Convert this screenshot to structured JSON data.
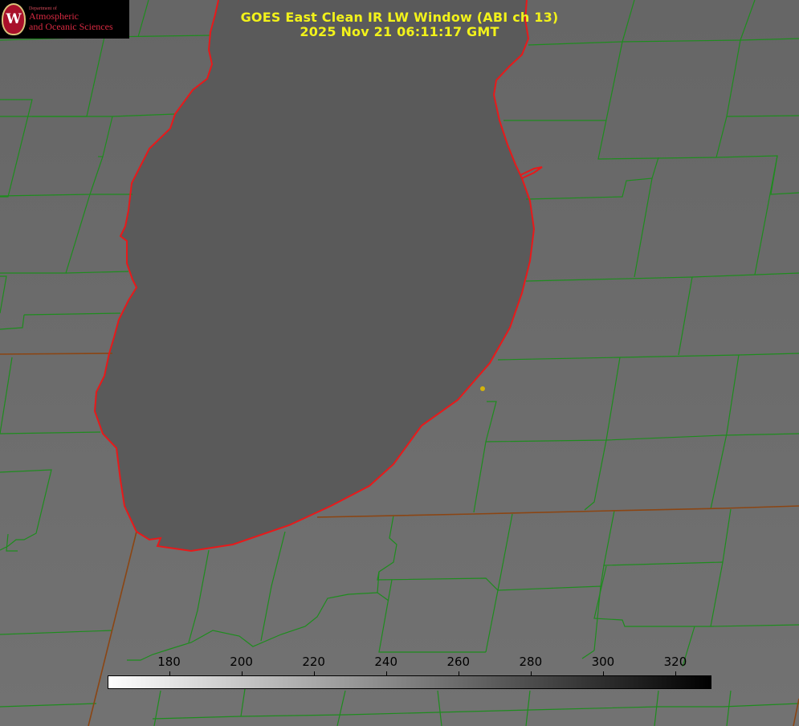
{
  "header": {
    "title_line1": "GOES East Clean IR LW Window (ABI ch 13)",
    "title_line2": "2025 Nov 21 06:11:17 GMT"
  },
  "logo": {
    "department": "Department of",
    "line1": "Atmospheric",
    "line2": "and Oceanic Sciences",
    "seal_letter": "W"
  },
  "colorbar": {
    "min": 163,
    "max": 330,
    "ticks": [
      "180",
      "200",
      "220",
      "240",
      "260",
      "280",
      "300",
      "320"
    ],
    "tick_values": [
      180,
      200,
      220,
      240,
      260,
      280,
      300,
      320
    ],
    "color_low": "#ffffff",
    "color_high": "#000000"
  },
  "colors": {
    "county_lines": "#1e8c1e",
    "state_lines": "#8b4513",
    "coastline": "#e8191a",
    "station_marker": "#d4b40a",
    "title_text": "#f2f21a"
  }
}
